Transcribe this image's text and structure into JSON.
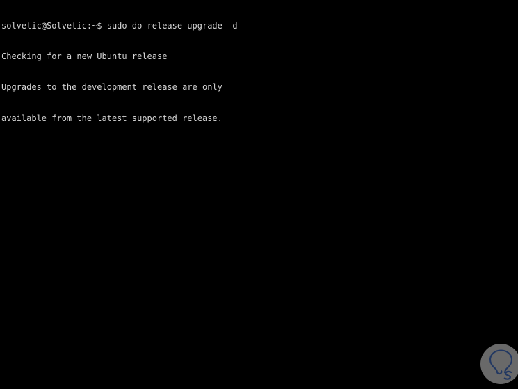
{
  "terminal": {
    "background_color": "#000000",
    "text_color": "#d4d4d4",
    "lines": [
      "solvetic@Solvetic:~$ sudo do-release-upgrade -d",
      "Checking for a new Ubuntu release",
      "Upgrades to the development release are only",
      "available from the latest supported release."
    ],
    "prompt": {
      "user": "solvetic",
      "host": "Solvetic",
      "path": "~",
      "symbol": "$",
      "command": "sudo do-release-upgrade -d"
    },
    "messages": [
      "Checking for a new Ubuntu release",
      "Upgrades to the development release are only",
      "available from the latest supported release."
    ]
  },
  "watermark": {
    "icon": "lightbulb-s-logo-icon",
    "letter": "S",
    "circle_color": "#6d6d6d",
    "mark_color": "#243a66"
  }
}
